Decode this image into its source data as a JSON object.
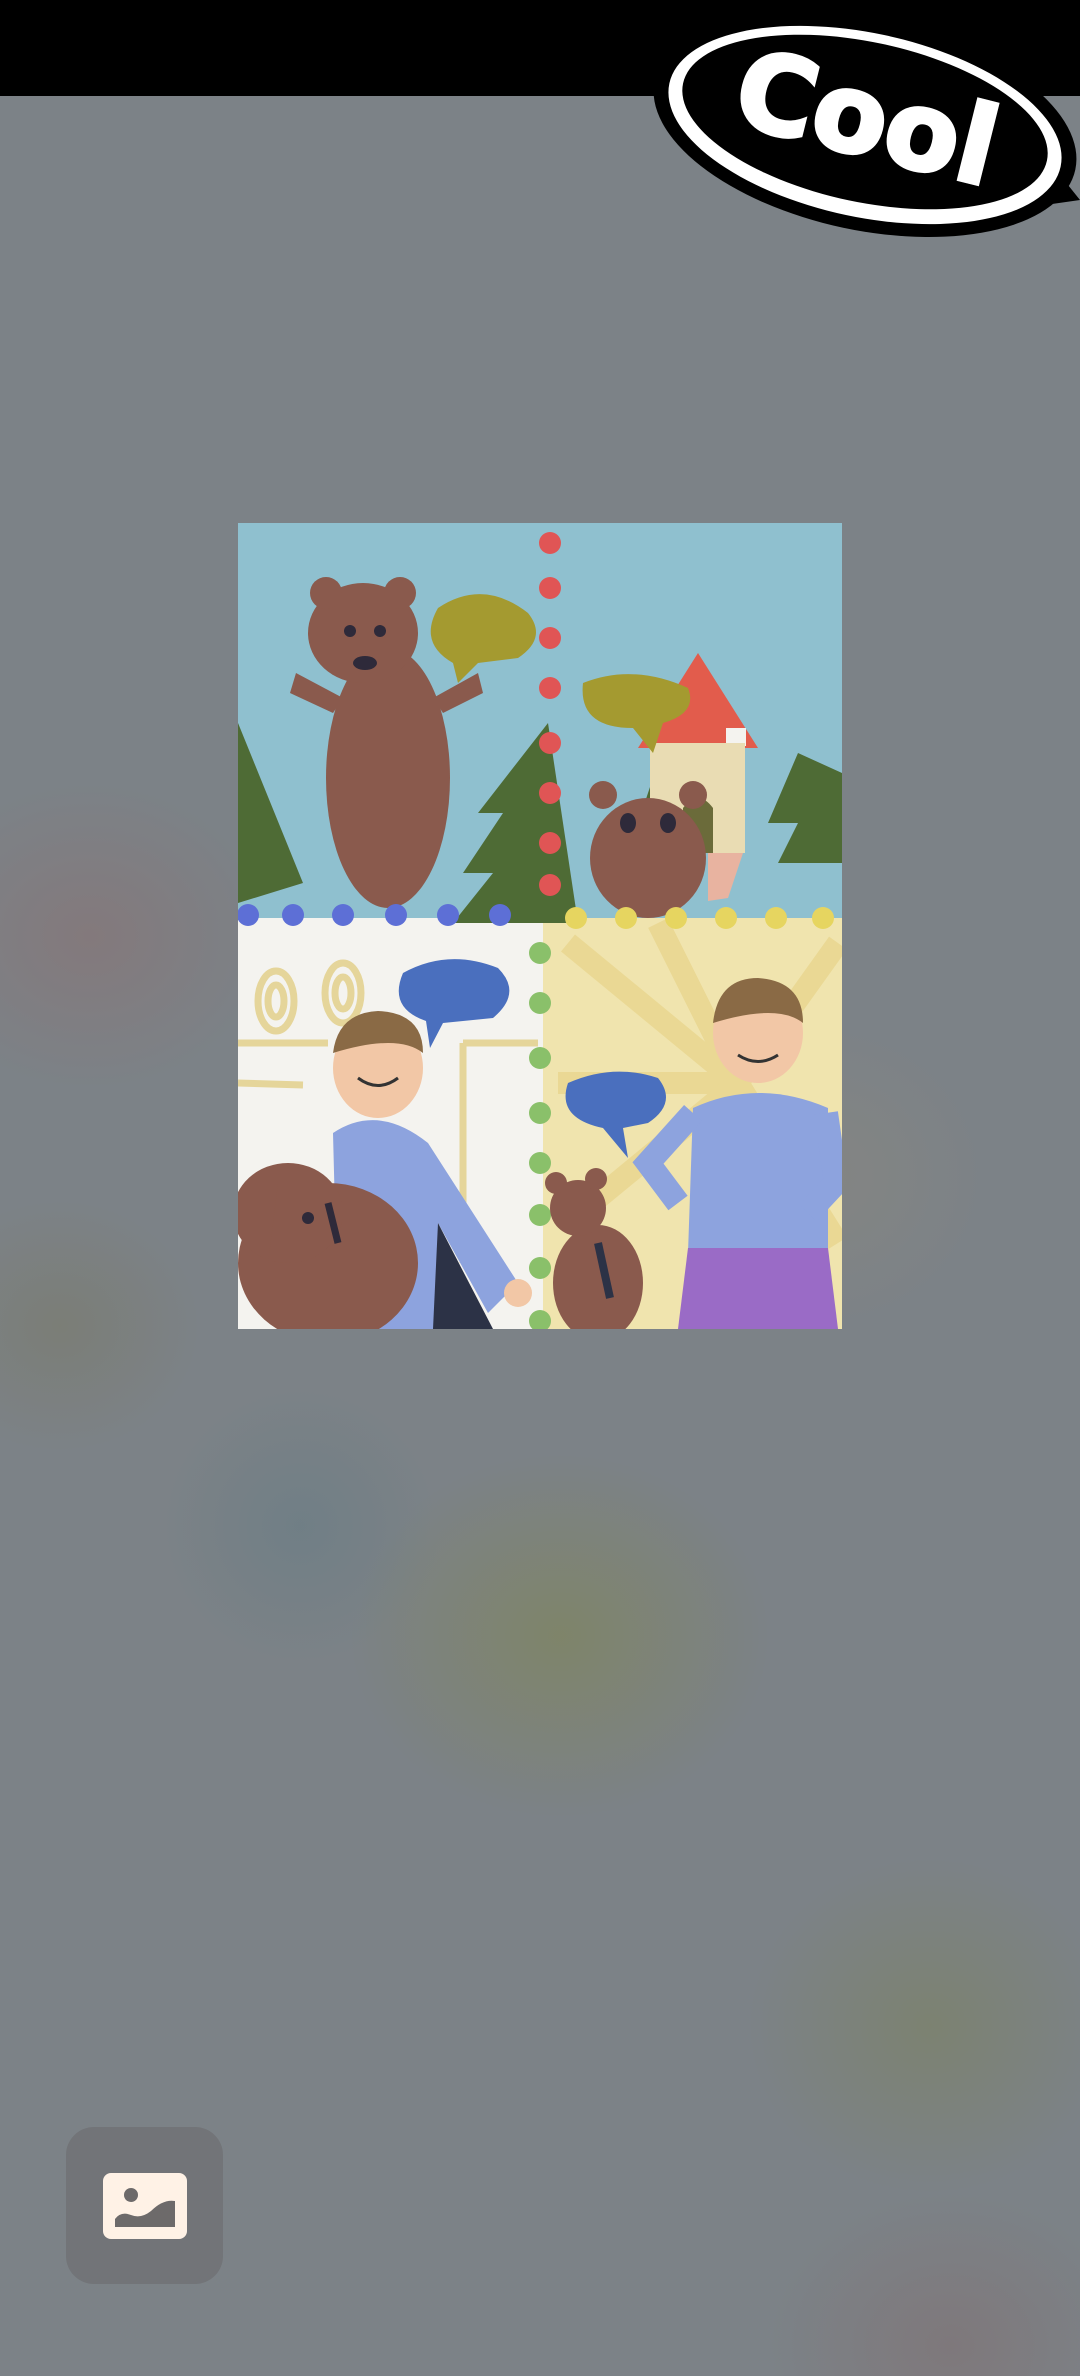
{
  "sticker": {
    "text": "Cool"
  },
  "drawing": {
    "top_panel": {
      "background": "#8fc0cf"
    },
    "bottom_panel": {
      "background": "#f4f3ef",
      "sun_color": "#f0e2a6"
    }
  },
  "controls": {
    "gallery_icon": "photo-card-icon"
  }
}
